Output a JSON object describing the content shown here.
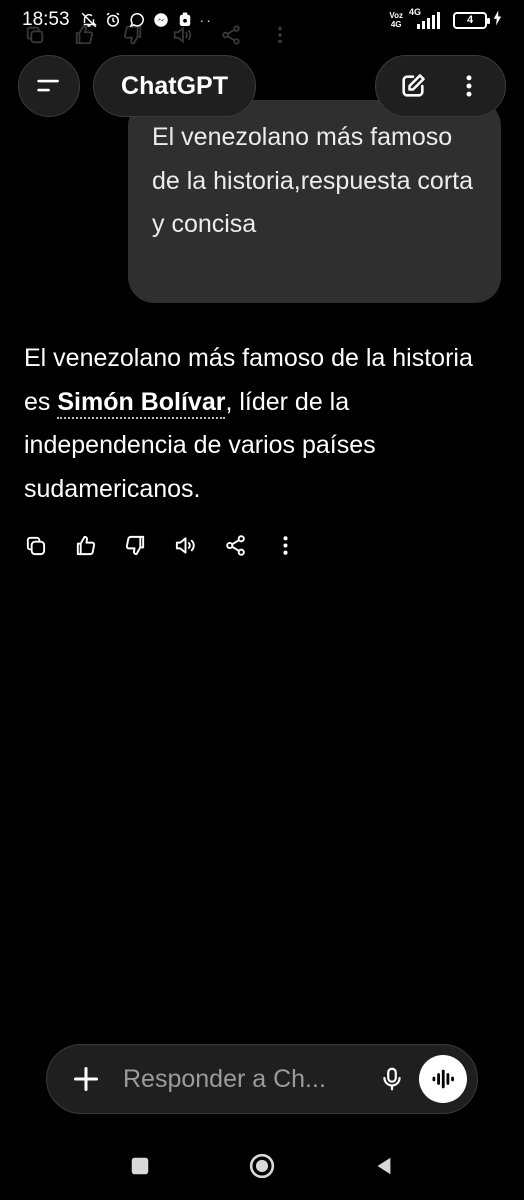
{
  "status_bar": {
    "time": "18:53",
    "network_top": "Voz",
    "network_bottom": "4G",
    "signal_label": "4G",
    "battery": "4"
  },
  "header": {
    "title": "ChatGPT"
  },
  "conversation": {
    "user_message": "El venezolano más famoso de la historia,respuesta corta y concisa",
    "assistant_before": "El venezolano más famoso de la historia es ",
    "assistant_bold": "Simón Bolívar",
    "assistant_after": ", líder de la independencia de varios países sudamericanos."
  },
  "composer": {
    "placeholder": "Responder a Ch..."
  },
  "icons": {
    "menu": "menu-icon",
    "new_chat": "edit-icon",
    "more": "more-vertical-icon",
    "copy": "copy-icon",
    "thumbs_up": "thumbs-up-icon",
    "thumbs_down": "thumbs-down-icon",
    "read_aloud": "speaker-icon",
    "share": "share-icon",
    "plus": "plus-icon",
    "mic": "mic-icon",
    "voice": "voice-mode-icon"
  },
  "colors": {
    "background": "#000000",
    "user_bubble": "#2f2f2f",
    "pill": "#1f1f1f",
    "placeholder": "#9b9b9b"
  }
}
